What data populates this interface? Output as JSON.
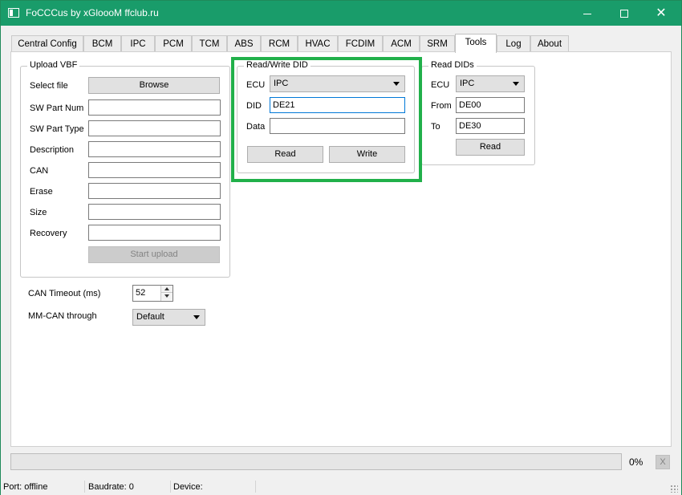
{
  "window": {
    "title": "FoCCCus by xGloooM ffclub.ru"
  },
  "tabs": [
    "Central Config",
    "BCM",
    "IPC",
    "PCM",
    "TCM",
    "ABS",
    "RCM",
    "HVAC",
    "FCDIM",
    "ACM",
    "SRM",
    "Tools",
    "Log",
    "About"
  ],
  "active_tab": "Tools",
  "upload_vbf": {
    "title": "Upload VBF",
    "select_file_label": "Select file",
    "browse_label": "Browse",
    "fields": [
      {
        "label": "SW Part Num",
        "value": ""
      },
      {
        "label": "SW Part Type",
        "value": ""
      },
      {
        "label": "Description",
        "value": ""
      },
      {
        "label": "CAN",
        "value": ""
      },
      {
        "label": "Erase",
        "value": ""
      },
      {
        "label": "Size",
        "value": ""
      },
      {
        "label": "Recovery",
        "value": ""
      }
    ],
    "start_upload_label": "Start upload"
  },
  "settings": {
    "can_timeout_label": "CAN Timeout (ms)",
    "can_timeout_value": "52",
    "mmcan_label": "MM-CAN through",
    "mmcan_value": "Default"
  },
  "rw_did": {
    "title": "Read/Write DID",
    "ecu_label": "ECU",
    "ecu_value": "IPC",
    "did_label": "DID",
    "did_value": "DE21",
    "data_label": "Data",
    "data_value": "",
    "read_label": "Read",
    "write_label": "Write"
  },
  "read_dids": {
    "title": "Read DIDs",
    "ecu_label": "ECU",
    "ecu_value": "IPC",
    "from_label": "From",
    "from_value": "DE00",
    "to_label": "To",
    "to_value": "DE30",
    "read_label": "Read"
  },
  "progress": {
    "percent_text": "0%",
    "fraction": 0,
    "cancel_label": "X"
  },
  "status": {
    "port": "Port: offline",
    "baudrate": "Baudrate: 0",
    "device": "Device:"
  },
  "colors": {
    "titlebar": "#199c6a",
    "highlight": "#21b04a"
  }
}
